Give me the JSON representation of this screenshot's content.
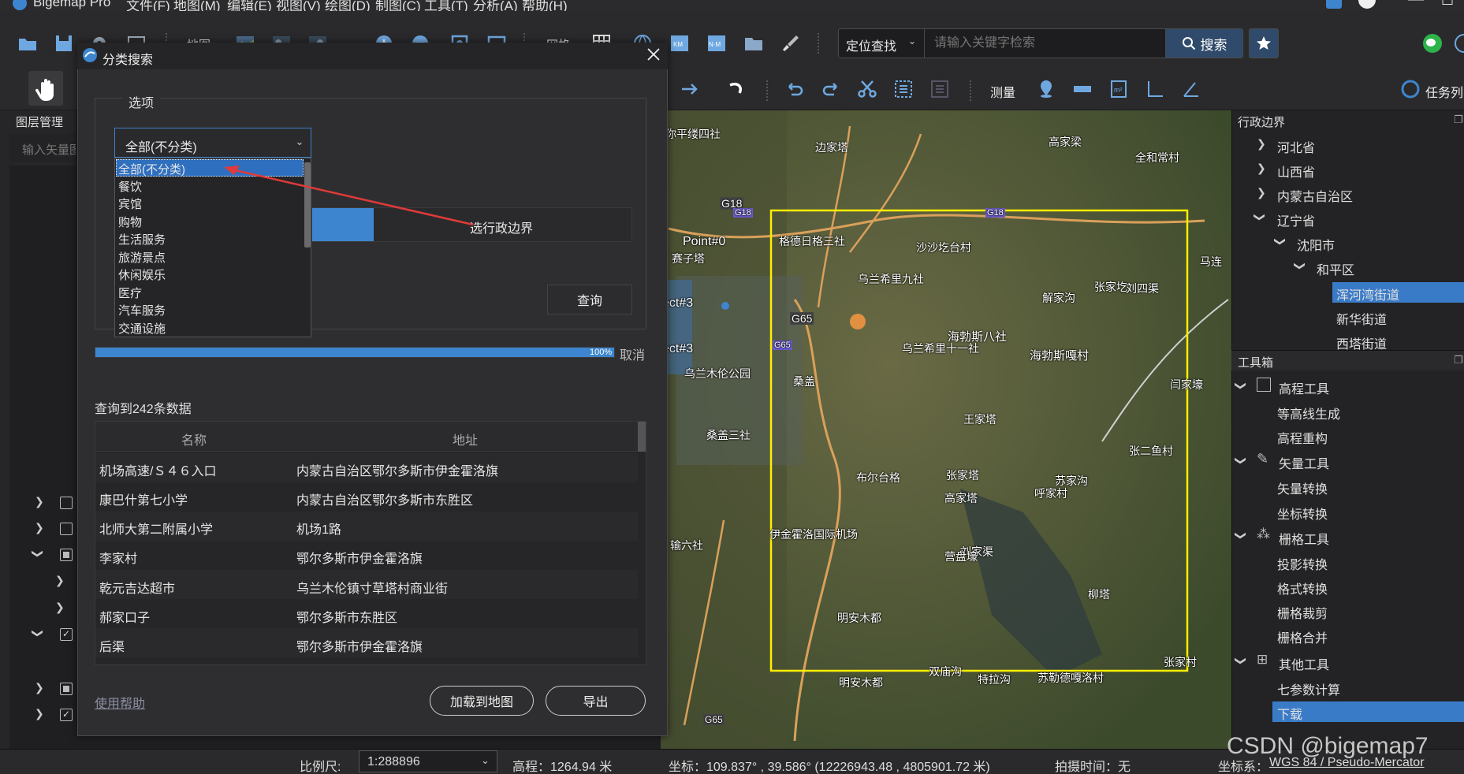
{
  "app": {
    "title": "Bigemap Pro",
    "menu": [
      "文件(F)",
      "地图(M)",
      "编辑(E)",
      "视图(V)",
      "绘图(D)",
      "制图(C)",
      "工具(T)",
      "分析(A)",
      "帮助(H)"
    ]
  },
  "toolbar": {
    "map_label": "地图",
    "grid_label": "网格",
    "measure_label": "测量",
    "task_label": "任务列",
    "search_mode": "定位查找",
    "search_placeholder": "请输入关键字检索",
    "search_button": "搜索"
  },
  "left_panel": {
    "title": "图层管理",
    "search_placeholder": "输入矢量图"
  },
  "dialog": {
    "title": "分类搜索",
    "options_label": "选项",
    "category_selected": "全部(不分类)",
    "category_options": [
      "全部(不分类)",
      "餐饮",
      "宾馆",
      "购物",
      "生活服务",
      "旅游景点",
      "休闲娱乐",
      "医疗",
      "汽车服务",
      "交通设施"
    ],
    "boundary_label": "选行政边界",
    "query_button": "查询",
    "progress_text": "100%",
    "progress_value": 1.0,
    "cancel_label": "取消",
    "result_count": "查询到242条数据",
    "table_headers": [
      "名称",
      "地址"
    ],
    "rows": [
      {
        "name": "机场高速/Ｓ４６入口",
        "address": "内蒙古自治区鄂尔多斯市伊金霍洛旗"
      },
      {
        "name": "康巴什第七小学",
        "address": "内蒙古自治区鄂尔多斯市东胜区"
      },
      {
        "name": "北师大第二附属小学",
        "address": "机场1路"
      },
      {
        "name": "李家村",
        "address": "鄂尔多斯市伊金霍洛旗"
      },
      {
        "name": "乾元吉达超市",
        "address": "乌兰木伦镇寸草塔村商业街"
      },
      {
        "name": "郝家口子",
        "address": "鄂尔多斯市东胜区"
      },
      {
        "name": "后渠",
        "address": "鄂尔多斯市伊金霍洛旗"
      }
    ],
    "help_link": "使用帮助",
    "load_button": "加载到地图",
    "export_button": "导出"
  },
  "map": {
    "labels": [
      "你平缕四社",
      "边家塔",
      "高家梁",
      "全和常村",
      "G18",
      "G18",
      "G18",
      "沙沙圪台村",
      "格德日格三社",
      "Point#0",
      "赛子塔",
      "乌兰希里九社",
      "马连",
      "张家圪",
      "刘四渠",
      "解家沟",
      "G65",
      "G65",
      "海勃斯八社",
      "乌兰希里十一社",
      "海勃斯嘎村",
      "乌兰木伦公园",
      "桑盖",
      "闫家壕",
      "王家塔",
      "桑盖三社",
      "张二鱼村",
      "张家塔",
      "布尔台格",
      "苏家沟",
      "高家塔",
      "呼家村",
      "伊金霍洛国际机场",
      "输六社",
      "刘家渠",
      "营盘壕",
      "柳塔",
      "明安木都",
      "明安木都",
      "双庙沟",
      "特拉沟",
      "苏勒德嘎洛村",
      "张家村",
      "G65",
      "ect#3",
      "ect#3"
    ]
  },
  "right_panel": {
    "admin_title": "行政边界",
    "admin_tree": [
      "河北省",
      "山西省",
      "内蒙古自治区",
      "辽宁省",
      "沈阳市",
      "和平区",
      "浑河湾街道",
      "新华街道",
      "西塔街道"
    ],
    "toolbox_title": "工具箱",
    "toolbox": [
      {
        "group": "高程工具",
        "items": [
          "等高线生成",
          "高程重构"
        ]
      },
      {
        "group": "矢量工具",
        "items": [
          "矢量转换",
          "坐标转换"
        ]
      },
      {
        "group": "栅格工具",
        "items": [
          "投影转换",
          "格式转换",
          "栅格裁剪",
          "栅格合并"
        ]
      },
      {
        "group": "其他工具",
        "items": [
          "七参数计算",
          "下载"
        ]
      }
    ]
  },
  "status": {
    "scale_label": "比例尺:",
    "scale_value": "1:288896",
    "elevation": "高程：1264.94 米",
    "coords": "坐标：109.837° , 39.586°  (12226943.48 , 4805901.72 米)",
    "capture_time": "拍摄时间：无",
    "crs_label": "坐标系：",
    "crs_value": "WGS 84 / Pseudo-Mercator"
  },
  "watermark": "CSDN @bigemap7",
  "colors": {
    "accent": "#3d86cf",
    "selection": "#2f6fbf",
    "bbox": "#ffee00",
    "arrow": "#e03a3a"
  }
}
